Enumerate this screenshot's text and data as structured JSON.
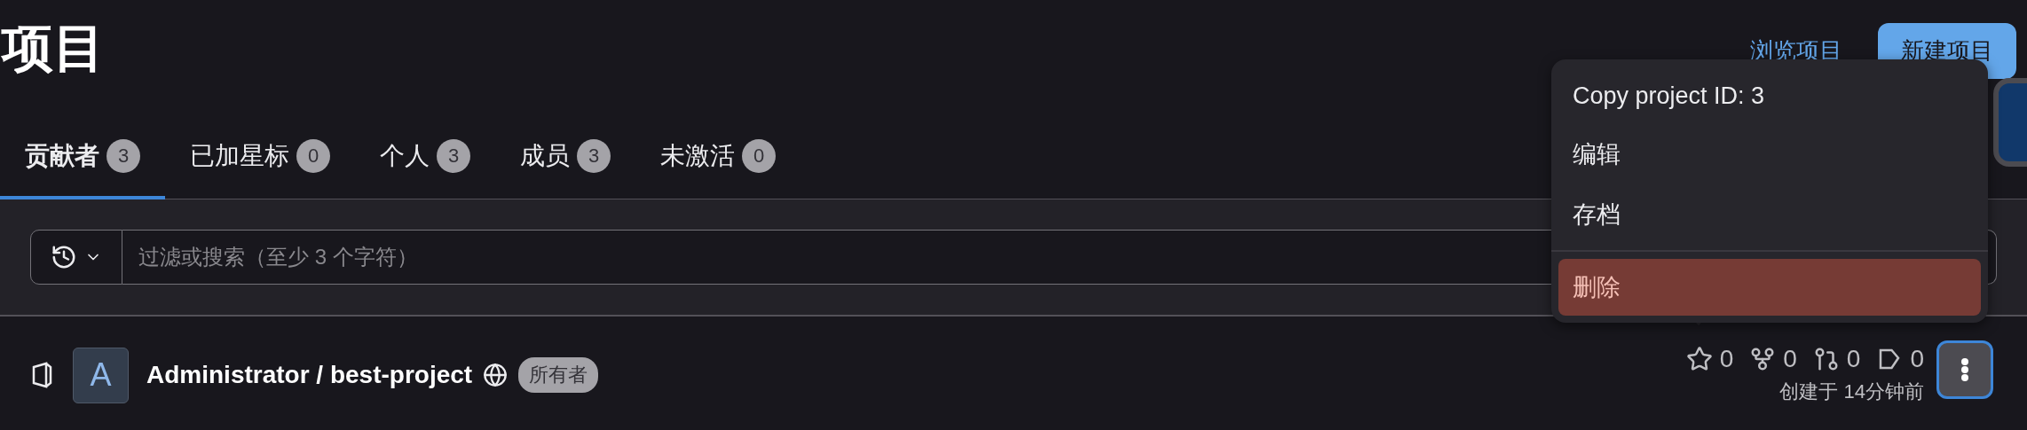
{
  "page_title": "项目",
  "header_actions": [
    {
      "kind": "link",
      "label": "浏览项目"
    },
    {
      "kind": "primary",
      "label": "新建项目"
    }
  ],
  "tabs": [
    {
      "label": "贡献者",
      "count": "3",
      "selected": true
    },
    {
      "label": "已加星标",
      "count": "0",
      "selected": false
    },
    {
      "label": "个人",
      "count": "3",
      "selected": false
    },
    {
      "label": "成员",
      "count": "3",
      "selected": false
    },
    {
      "label": "未激活",
      "count": "0",
      "selected": false
    }
  ],
  "filter": {
    "placeholder": "过滤或搜索（至少 3 个字符）"
  },
  "project": {
    "avatar": "A",
    "name": "Administrator / best-project",
    "role": "所有者",
    "stats": [
      {
        "kind": "stars",
        "value": "0"
      },
      {
        "kind": "forks",
        "value": "0"
      },
      {
        "kind": "merge_requests",
        "value": "0"
      },
      {
        "kind": "issues",
        "value": "0"
      }
    ],
    "created": "创建于 14分钟前"
  },
  "menu": {
    "items": [
      {
        "kind": "normal",
        "label": "Copy project ID: 3",
        "selected": false
      },
      {
        "kind": "normal",
        "label": "编辑",
        "selected": false
      },
      {
        "kind": "normal",
        "label": "存档",
        "selected": false
      },
      {
        "kind": "danger",
        "label": "删除",
        "selected": true
      }
    ]
  }
}
